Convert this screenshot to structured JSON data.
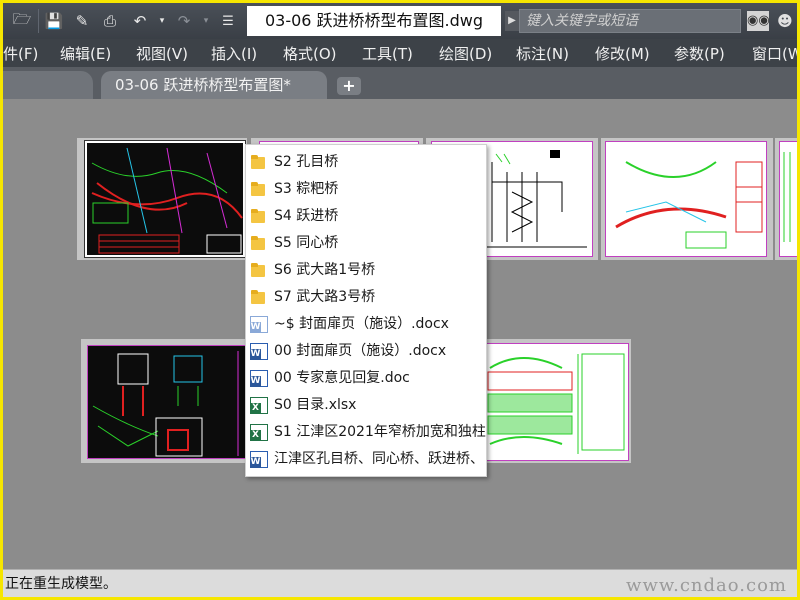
{
  "titlebar": {
    "document_title": "03-06 跃进桥桥型布置图.dwg",
    "search_placeholder": "键入关键字或短语",
    "quick_access": [
      "open-icon",
      "save-icon",
      "saveas-icon",
      "print-icon",
      "undo-icon",
      "redo-icon",
      "customize-icon"
    ]
  },
  "menubar": {
    "items": [
      {
        "label": "件(F)"
      },
      {
        "label": "编辑(E)"
      },
      {
        "label": "视图(V)"
      },
      {
        "label": "插入(I)"
      },
      {
        "label": "格式(O)"
      },
      {
        "label": "工具(T)"
      },
      {
        "label": "绘图(D)"
      },
      {
        "label": "标注(N)"
      },
      {
        "label": "修改(M)"
      },
      {
        "label": "参数(P)"
      },
      {
        "label": "窗口(W"
      }
    ]
  },
  "tabs": {
    "active_label": "03-06 跃进桥桥型布置图*",
    "new_tab_label": "+"
  },
  "file_list": {
    "items": [
      {
        "type": "folder",
        "label": "S2 孔目桥"
      },
      {
        "type": "folder",
        "label": "S3 粽粑桥"
      },
      {
        "type": "folder",
        "label": "S4 跃进桥"
      },
      {
        "type": "folder",
        "label": "S5 同心桥"
      },
      {
        "type": "folder",
        "label": "S6 武大路1号桥"
      },
      {
        "type": "folder",
        "label": "S7 武大路3号桥"
      },
      {
        "type": "word-temp",
        "label": "~$ 封面扉页（施设）.docx"
      },
      {
        "type": "word",
        "label": "00 封面扉页（施设）.docx"
      },
      {
        "type": "word",
        "label": "00 专家意见回复.doc"
      },
      {
        "type": "excel",
        "label": "S0 目录.xlsx"
      },
      {
        "type": "excel-doc",
        "label": "S1 江津区2021年窄桥加宽和独柱"
      },
      {
        "type": "word",
        "label": "江津区孔目桥、同心桥、跃进桥、"
      }
    ]
  },
  "status": {
    "text": "正在重生成模型。",
    "watermark": "www.cndao.com"
  }
}
